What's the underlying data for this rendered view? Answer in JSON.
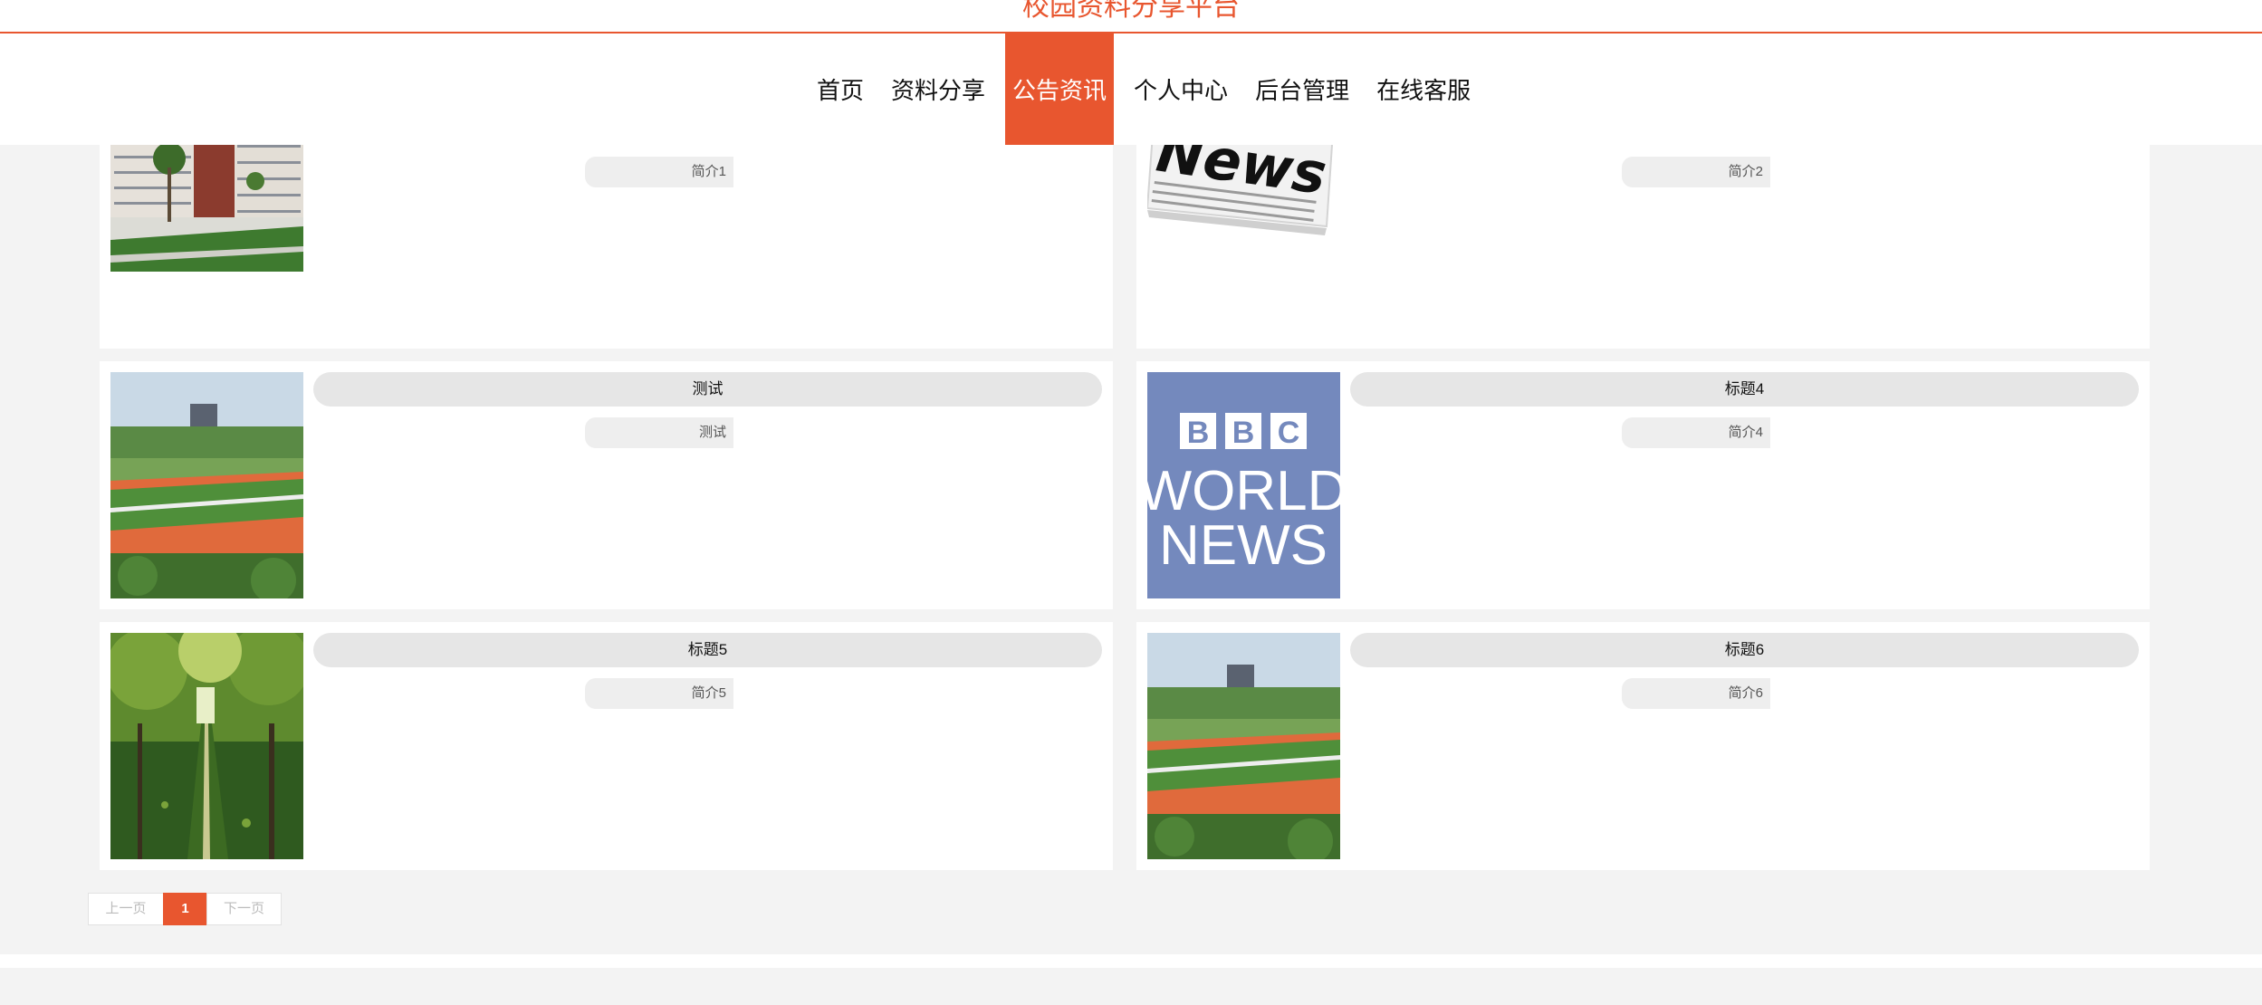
{
  "header": {
    "site_title": "校园资料分享平台",
    "brand_color": "#e8562f"
  },
  "nav": {
    "items": [
      {
        "label": "首页",
        "active": false
      },
      {
        "label": "资料分享",
        "active": false
      },
      {
        "label": "公告资讯",
        "active": true
      },
      {
        "label": "个人中心",
        "active": false
      },
      {
        "label": "后台管理",
        "active": false
      },
      {
        "label": "在线客服",
        "active": false
      }
    ]
  },
  "news": [
    {
      "title": "",
      "summary": "简介1",
      "image": "campus-building-photo"
    },
    {
      "title": "",
      "summary": "简介2",
      "image": "newspaper-news-photo"
    },
    {
      "title": "测试",
      "summary": "测试",
      "image": "sports-field-photo"
    },
    {
      "title": "标题4",
      "summary": "简介4",
      "image": "bbc-world-news-logo"
    },
    {
      "title": "标题5",
      "summary": "简介5",
      "image": "tree-lined-path-photo"
    },
    {
      "title": "标题6",
      "summary": "简介6",
      "image": "sports-field-photo"
    }
  ],
  "bbc_logo": {
    "letters": [
      "B",
      "B",
      "C"
    ],
    "line1": "WORLD",
    "line2": "NEWS"
  },
  "newspaper_word": "News",
  "pagination": {
    "prev": "上一页",
    "current": "1",
    "next": "下一页"
  }
}
